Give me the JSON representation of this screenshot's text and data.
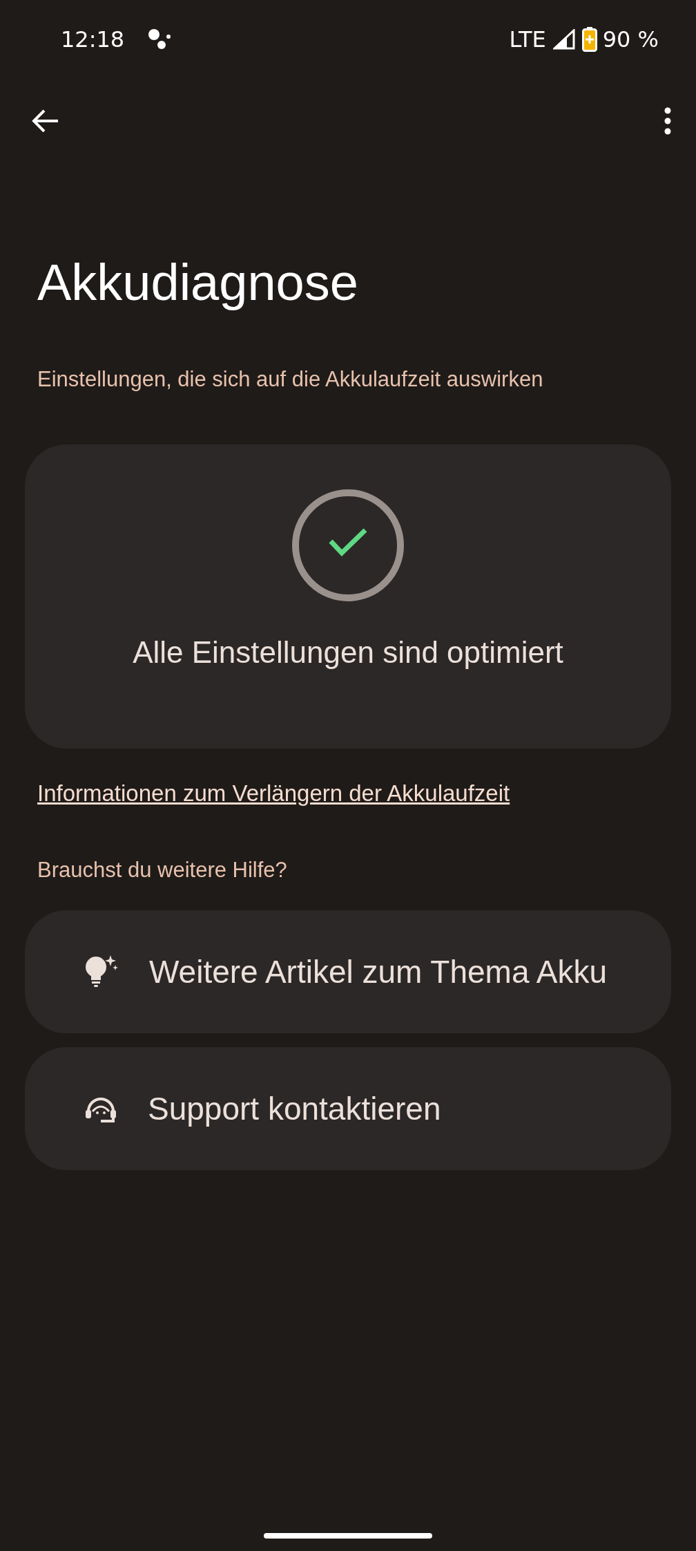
{
  "status_bar": {
    "time": "12:18",
    "network": "LTE",
    "battery": "90 %"
  },
  "title": "Akkudiagnose",
  "section_heading": "Einstellungen, die sich auf die Akkulaufzeit auswirken",
  "status_card": {
    "text": "Alle Einstellungen sind optimiert"
  },
  "link": "Informationen zum Verlängern der Akkulaufzeit",
  "help_heading": "Brauchst du weitere Hilfe?",
  "help_items": [
    {
      "kind": "articles",
      "label": "Weitere Artikel zum Thema Akku"
    },
    {
      "kind": "support",
      "label": "Support kontaktieren"
    }
  ]
}
